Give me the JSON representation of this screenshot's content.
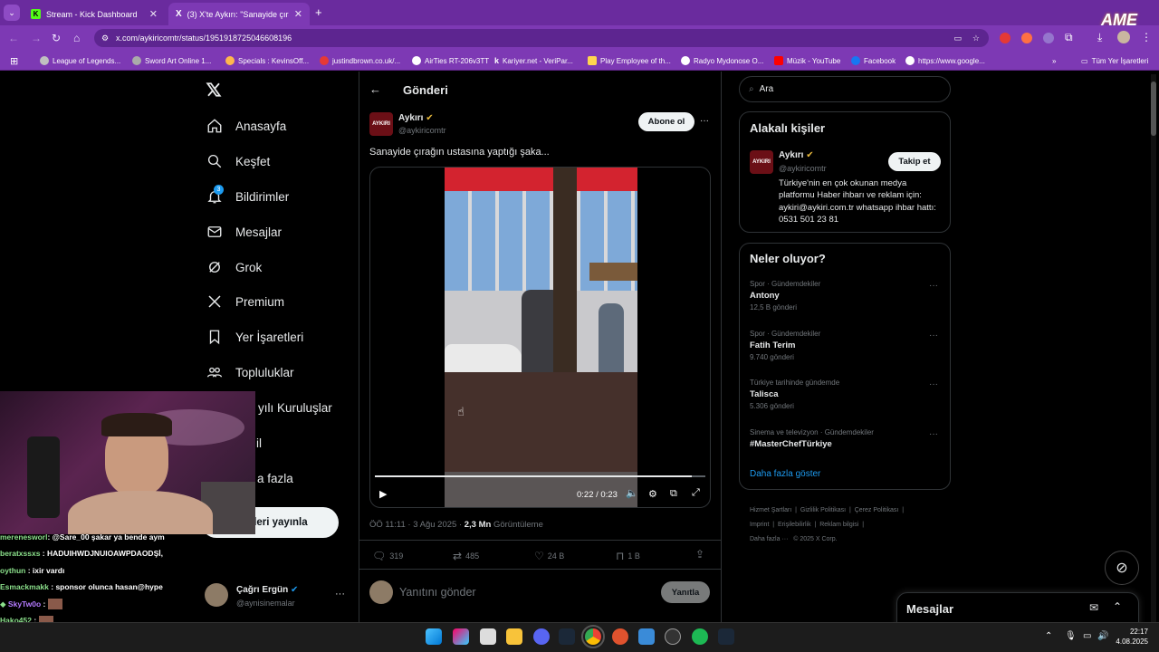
{
  "browser": {
    "tabs": [
      {
        "title": "Stream - Kick Dashboard",
        "icon_letter": "K"
      },
      {
        "title": "(3) X'te Aykırı: \"Sanayide çırağı",
        "icon_letter": "X"
      }
    ],
    "new_tab_label": "+",
    "url": "x.com/aykiricomtr/status/1951918725046608196",
    "bookmarks": [
      "League of Legends...",
      "Sword Art Online 1...",
      "Specials : KevinsOff...",
      "justindbrown.co.uk/...",
      "AirTies RT-206v3TT",
      "Kariyer.net - VeriPar...",
      "Play Employee of th...",
      "Radyo Mydonose O...",
      "Müzik - YouTube",
      "Facebook",
      "https://www.google..."
    ],
    "all_bookmarks": "Tüm Yer İşaretleri",
    "overlay_text": "AME"
  },
  "nav": {
    "items": [
      "Anasayfa",
      "Keşfet",
      "Bildirimler",
      "Mesajlar",
      "Grok",
      "Premium",
      "Yer İşaretleri",
      "Topluluklar",
      "yılı Kuruluşlar",
      "il",
      "a fazla"
    ],
    "notif_badge": "3",
    "post_button": "deri yayınla",
    "account_name": "Çağrı Ergün",
    "account_handle": "@aynisinemalar",
    "more": "···"
  },
  "post": {
    "header": "Gönderi",
    "author_name": "Aykırı",
    "author_handle": "@aykiricomtr",
    "subscribe": "Abone ol",
    "text": "Sanayide çırağın ustasına yaptığı şaka...",
    "video_time": "0:22 / 0:23",
    "video_progress": 0.96,
    "timestamp": "ÖÖ 11:11 · 3 Ağu 2025 · ",
    "views": "2,3 Mn",
    "views_label": "Görüntüleme",
    "replies": "319",
    "reposts": "485",
    "likes": "24 B",
    "bookmarks": "1 B",
    "reply_placeholder": "Yanıtını gönder",
    "reply_button": "Yanıtla"
  },
  "sidebar": {
    "search_placeholder": "Ara",
    "related_title": "Alakalı kişiler",
    "related_name": "Aykırı",
    "related_handle": "@aykiricomtr",
    "follow": "Takip et",
    "bio": "Türkiye'nin en çok okunan medya platformu Haber ihbarı ve reklam için: aykiri@aykiri.com.tr whatsapp ihbar hattı: 0531 501 23 81",
    "trends_title": "Neler oluyor?",
    "trends": [
      {
        "meta": "Spor · Gündemdekiler",
        "title": "Antony",
        "count": "12,5 B gönderi"
      },
      {
        "meta": "Spor · Gündemdekiler",
        "title": "Fatih Terim",
        "count": "9.740 gönderi"
      },
      {
        "meta": "Türkiye tarihinde gündemde",
        "title": "Talisca",
        "count": "5.306 gönderi"
      },
      {
        "meta": "Sinema ve televizyon · Gündemdekiler",
        "title": "#MasterChefTürkiye",
        "count": ""
      }
    ],
    "show_more": "Daha fazla göster",
    "footer": [
      "Hizmet Şartları",
      "Gizlilik Politikası",
      "Çerez Politikası",
      "Imprint",
      "Erişilebilirlik",
      "Reklam bilgisi",
      "Daha fazla ···",
      "© 2025 X Corp."
    ],
    "messages": "Mesajlar"
  },
  "chat": [
    {
      "user": "merenesworl",
      "msg": ": @Sare_00 şakar ya bende aym",
      "color": "#8be08b"
    },
    {
      "user": "beratxssxs",
      "msg": ": HADUIHWDJNUIOAWPDAODŞİ,",
      "color": "#8be08b"
    },
    {
      "user": "oythun",
      "msg": ": ixir vardı",
      "color": "#8be08b"
    },
    {
      "user": "Esmackmakk",
      "msg": ": sponsor olunca hasan@hype",
      "color": "#8be08b"
    },
    {
      "user": "SkyTw0o",
      "msg": ":",
      "color": "#b57bff"
    },
    {
      "user": "Hako452",
      "msg": ":",
      "color": "#8be08b"
    }
  ],
  "taskbar": {
    "time": "22:17",
    "date": "4.08.2025"
  }
}
